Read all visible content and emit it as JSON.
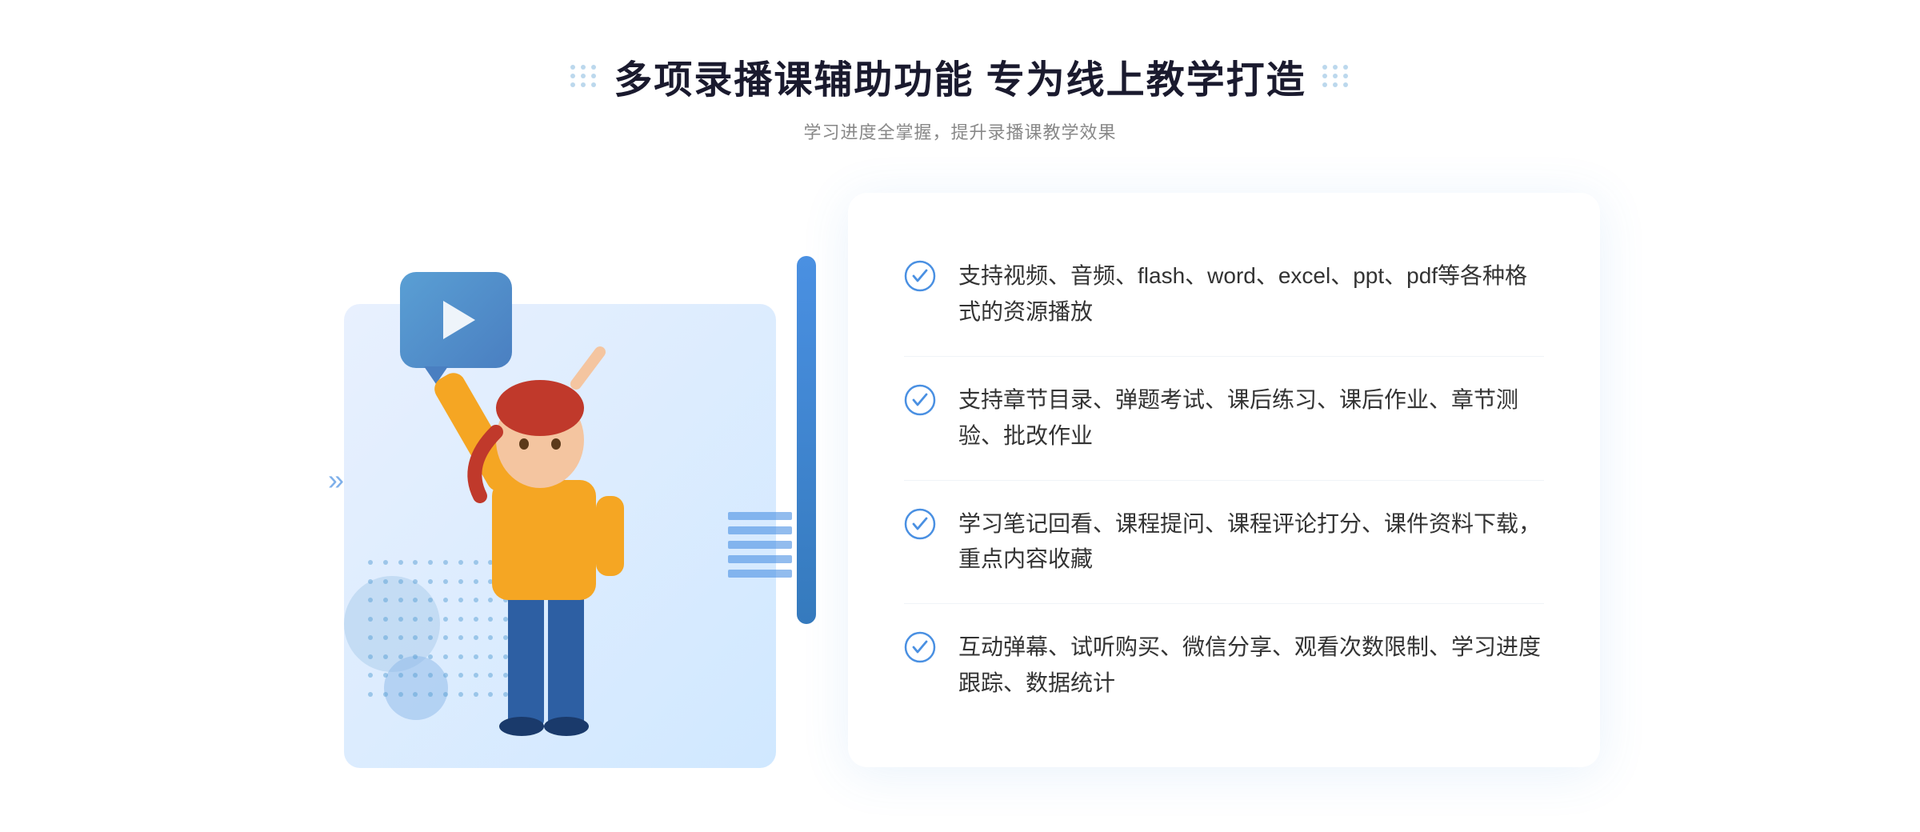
{
  "header": {
    "main_title": "多项录播课辅助功能 专为线上教学打造",
    "sub_title": "学习进度全掌握，提升录播课教学效果"
  },
  "features": [
    {
      "id": "feature-1",
      "text": "支持视频、音频、flash、word、excel、ppt、pdf等各种格式的资源播放"
    },
    {
      "id": "feature-2",
      "text": "支持章节目录、弹题考试、课后练习、课后作业、章节测验、批改作业"
    },
    {
      "id": "feature-3",
      "text": "学习笔记回看、课程提问、课程评论打分、课件资料下载，重点内容收藏"
    },
    {
      "id": "feature-4",
      "text": "互动弹幕、试听购买、微信分享、观看次数限制、学习进度跟踪、数据统计"
    }
  ],
  "decorations": {
    "left_arrow": "»",
    "accent_color": "#4a90e2"
  }
}
